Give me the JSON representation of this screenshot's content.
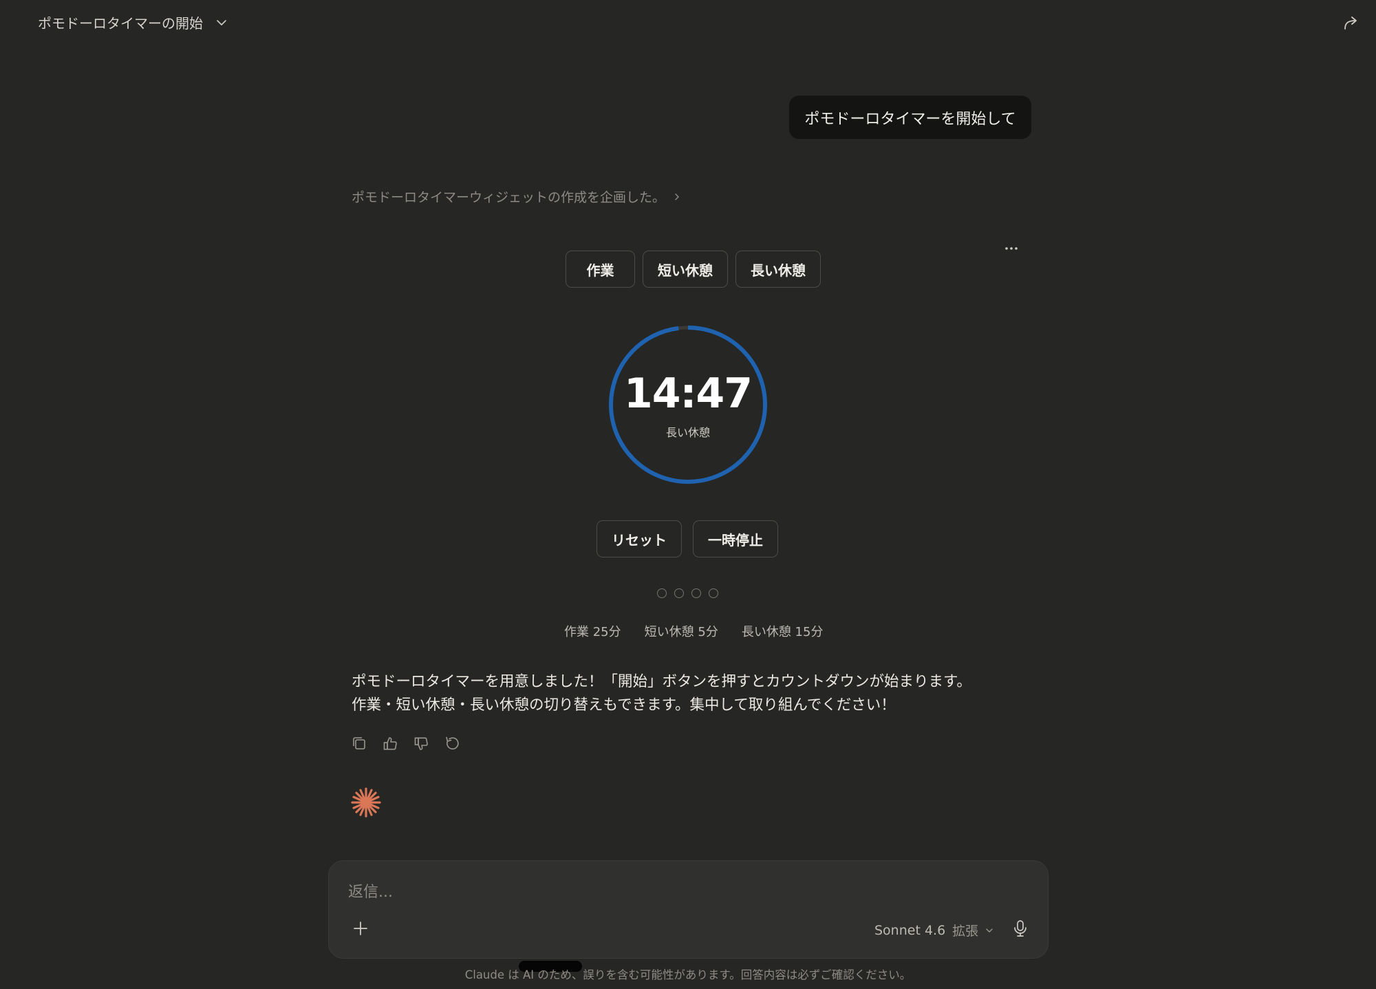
{
  "header": {
    "title": "ポモドーロタイマーの開始"
  },
  "user_message": "ポモドーロタイマーを開始して",
  "thinking_summary": "ポモドーロタイマーウィジェットの作成を企画した。",
  "widget": {
    "modes": [
      "作業",
      "短い休憩",
      "長い休憩"
    ],
    "time": "14:47",
    "mode_label": "長い休憩",
    "progress": 0.98,
    "ring_color": "#1f63b0",
    "controls": {
      "reset": "リセット",
      "pause": "一時停止"
    },
    "sessions_completed": 0,
    "sessions_total": 4,
    "durations": [
      "作業 25分",
      "短い休憩 5分",
      "長い休憩 15分"
    ]
  },
  "response": {
    "line1": "ポモドーロタイマーを用意しました！「開始」ボタンを押すとカウントダウンが始まります。",
    "line2": "作業・短い休憩・長い休憩の切り替えもできます。集中して取り組んでください！"
  },
  "composer": {
    "placeholder": "返信...",
    "model": "Sonnet 4.6",
    "mode": "拡張"
  },
  "disclaimer": "Claude は AI のため、誤りを含む可能性があります。回答内容は必ずご確認ください。",
  "colors": {
    "background": "#262624",
    "accent_spark": "#d97757"
  }
}
